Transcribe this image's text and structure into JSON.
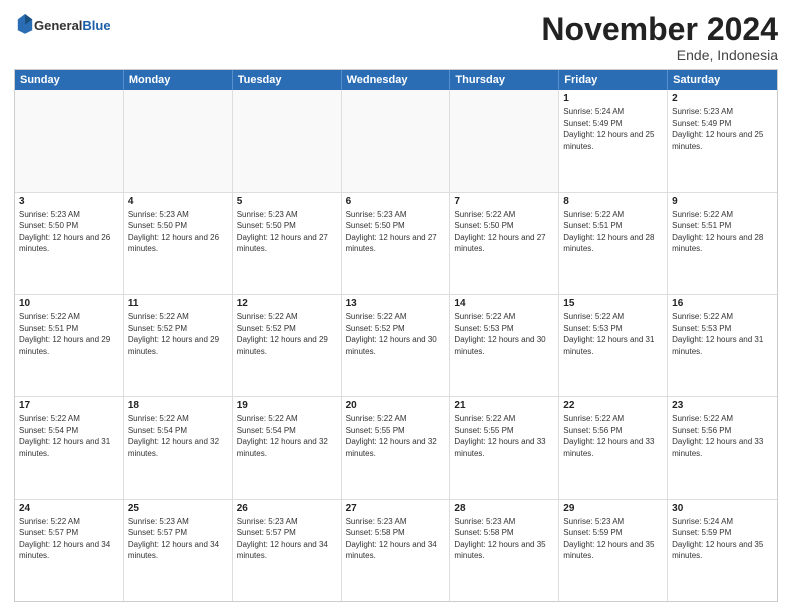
{
  "logo": {
    "general": "General",
    "blue": "Blue"
  },
  "title": {
    "month": "November 2024",
    "location": "Ende, Indonesia"
  },
  "header": {
    "days": [
      "Sunday",
      "Monday",
      "Tuesday",
      "Wednesday",
      "Thursday",
      "Friday",
      "Saturday"
    ]
  },
  "rows": [
    [
      {
        "day": "",
        "empty": true
      },
      {
        "day": "",
        "empty": true
      },
      {
        "day": "",
        "empty": true
      },
      {
        "day": "",
        "empty": true
      },
      {
        "day": "",
        "empty": true
      },
      {
        "day": "1",
        "sunrise": "Sunrise: 5:24 AM",
        "sunset": "Sunset: 5:49 PM",
        "daylight": "Daylight: 12 hours and 25 minutes."
      },
      {
        "day": "2",
        "sunrise": "Sunrise: 5:23 AM",
        "sunset": "Sunset: 5:49 PM",
        "daylight": "Daylight: 12 hours and 25 minutes."
      }
    ],
    [
      {
        "day": "3",
        "sunrise": "Sunrise: 5:23 AM",
        "sunset": "Sunset: 5:50 PM",
        "daylight": "Daylight: 12 hours and 26 minutes."
      },
      {
        "day": "4",
        "sunrise": "Sunrise: 5:23 AM",
        "sunset": "Sunset: 5:50 PM",
        "daylight": "Daylight: 12 hours and 26 minutes."
      },
      {
        "day": "5",
        "sunrise": "Sunrise: 5:23 AM",
        "sunset": "Sunset: 5:50 PM",
        "daylight": "Daylight: 12 hours and 27 minutes."
      },
      {
        "day": "6",
        "sunrise": "Sunrise: 5:23 AM",
        "sunset": "Sunset: 5:50 PM",
        "daylight": "Daylight: 12 hours and 27 minutes."
      },
      {
        "day": "7",
        "sunrise": "Sunrise: 5:22 AM",
        "sunset": "Sunset: 5:50 PM",
        "daylight": "Daylight: 12 hours and 27 minutes."
      },
      {
        "day": "8",
        "sunrise": "Sunrise: 5:22 AM",
        "sunset": "Sunset: 5:51 PM",
        "daylight": "Daylight: 12 hours and 28 minutes."
      },
      {
        "day": "9",
        "sunrise": "Sunrise: 5:22 AM",
        "sunset": "Sunset: 5:51 PM",
        "daylight": "Daylight: 12 hours and 28 minutes."
      }
    ],
    [
      {
        "day": "10",
        "sunrise": "Sunrise: 5:22 AM",
        "sunset": "Sunset: 5:51 PM",
        "daylight": "Daylight: 12 hours and 29 minutes."
      },
      {
        "day": "11",
        "sunrise": "Sunrise: 5:22 AM",
        "sunset": "Sunset: 5:52 PM",
        "daylight": "Daylight: 12 hours and 29 minutes."
      },
      {
        "day": "12",
        "sunrise": "Sunrise: 5:22 AM",
        "sunset": "Sunset: 5:52 PM",
        "daylight": "Daylight: 12 hours and 29 minutes."
      },
      {
        "day": "13",
        "sunrise": "Sunrise: 5:22 AM",
        "sunset": "Sunset: 5:52 PM",
        "daylight": "Daylight: 12 hours and 30 minutes."
      },
      {
        "day": "14",
        "sunrise": "Sunrise: 5:22 AM",
        "sunset": "Sunset: 5:53 PM",
        "daylight": "Daylight: 12 hours and 30 minutes."
      },
      {
        "day": "15",
        "sunrise": "Sunrise: 5:22 AM",
        "sunset": "Sunset: 5:53 PM",
        "daylight": "Daylight: 12 hours and 31 minutes."
      },
      {
        "day": "16",
        "sunrise": "Sunrise: 5:22 AM",
        "sunset": "Sunset: 5:53 PM",
        "daylight": "Daylight: 12 hours and 31 minutes."
      }
    ],
    [
      {
        "day": "17",
        "sunrise": "Sunrise: 5:22 AM",
        "sunset": "Sunset: 5:54 PM",
        "daylight": "Daylight: 12 hours and 31 minutes."
      },
      {
        "day": "18",
        "sunrise": "Sunrise: 5:22 AM",
        "sunset": "Sunset: 5:54 PM",
        "daylight": "Daylight: 12 hours and 32 minutes."
      },
      {
        "day": "19",
        "sunrise": "Sunrise: 5:22 AM",
        "sunset": "Sunset: 5:54 PM",
        "daylight": "Daylight: 12 hours and 32 minutes."
      },
      {
        "day": "20",
        "sunrise": "Sunrise: 5:22 AM",
        "sunset": "Sunset: 5:55 PM",
        "daylight": "Daylight: 12 hours and 32 minutes."
      },
      {
        "day": "21",
        "sunrise": "Sunrise: 5:22 AM",
        "sunset": "Sunset: 5:55 PM",
        "daylight": "Daylight: 12 hours and 33 minutes."
      },
      {
        "day": "22",
        "sunrise": "Sunrise: 5:22 AM",
        "sunset": "Sunset: 5:56 PM",
        "daylight": "Daylight: 12 hours and 33 minutes."
      },
      {
        "day": "23",
        "sunrise": "Sunrise: 5:22 AM",
        "sunset": "Sunset: 5:56 PM",
        "daylight": "Daylight: 12 hours and 33 minutes."
      }
    ],
    [
      {
        "day": "24",
        "sunrise": "Sunrise: 5:22 AM",
        "sunset": "Sunset: 5:57 PM",
        "daylight": "Daylight: 12 hours and 34 minutes."
      },
      {
        "day": "25",
        "sunrise": "Sunrise: 5:23 AM",
        "sunset": "Sunset: 5:57 PM",
        "daylight": "Daylight: 12 hours and 34 minutes."
      },
      {
        "day": "26",
        "sunrise": "Sunrise: 5:23 AM",
        "sunset": "Sunset: 5:57 PM",
        "daylight": "Daylight: 12 hours and 34 minutes."
      },
      {
        "day": "27",
        "sunrise": "Sunrise: 5:23 AM",
        "sunset": "Sunset: 5:58 PM",
        "daylight": "Daylight: 12 hours and 34 minutes."
      },
      {
        "day": "28",
        "sunrise": "Sunrise: 5:23 AM",
        "sunset": "Sunset: 5:58 PM",
        "daylight": "Daylight: 12 hours and 35 minutes."
      },
      {
        "day": "29",
        "sunrise": "Sunrise: 5:23 AM",
        "sunset": "Sunset: 5:59 PM",
        "daylight": "Daylight: 12 hours and 35 minutes."
      },
      {
        "day": "30",
        "sunrise": "Sunrise: 5:24 AM",
        "sunset": "Sunset: 5:59 PM",
        "daylight": "Daylight: 12 hours and 35 minutes."
      }
    ]
  ]
}
